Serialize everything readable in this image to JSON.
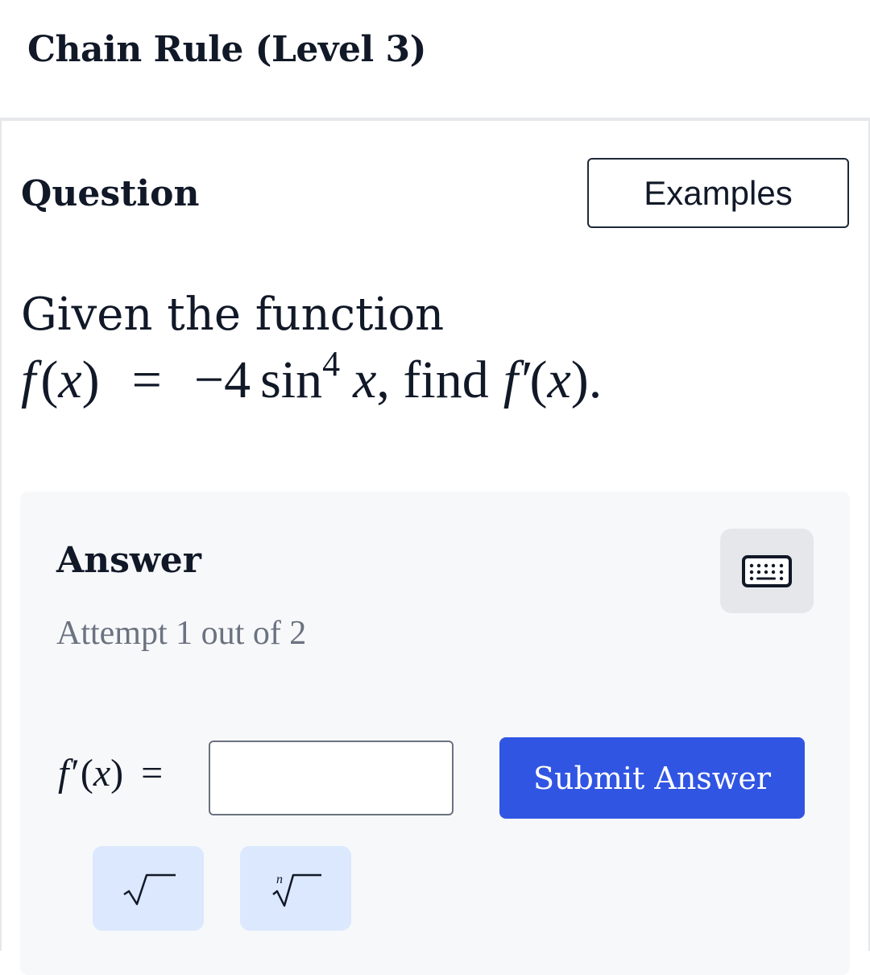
{
  "header": {
    "title": "Chain Rule (Level 3)"
  },
  "question": {
    "heading": "Question",
    "examples_label": "Examples",
    "intro": "Given the function",
    "fn_f": "f",
    "fn_x": "x",
    "fn_coef": "−4",
    "fn_sin": "sin",
    "fn_power": "4",
    "find_text": ", find",
    "deriv_f": "f′",
    "deriv_x": "x"
  },
  "answer": {
    "heading": "Answer",
    "attempt": "Attempt 1 out of 2",
    "label_f": "f′",
    "label_x": "x",
    "input_value": "",
    "submit_label": "Submit Answer",
    "nroot_index": "n"
  },
  "icons": {
    "keyboard": "keyboard-icon",
    "sqrt": "square-root-icon",
    "nroot": "nth-root-icon"
  },
  "colors": {
    "submit_bg": "#3155e3",
    "math_button_bg": "#dbe8fd",
    "panel_bg": "#f7f8fa"
  }
}
